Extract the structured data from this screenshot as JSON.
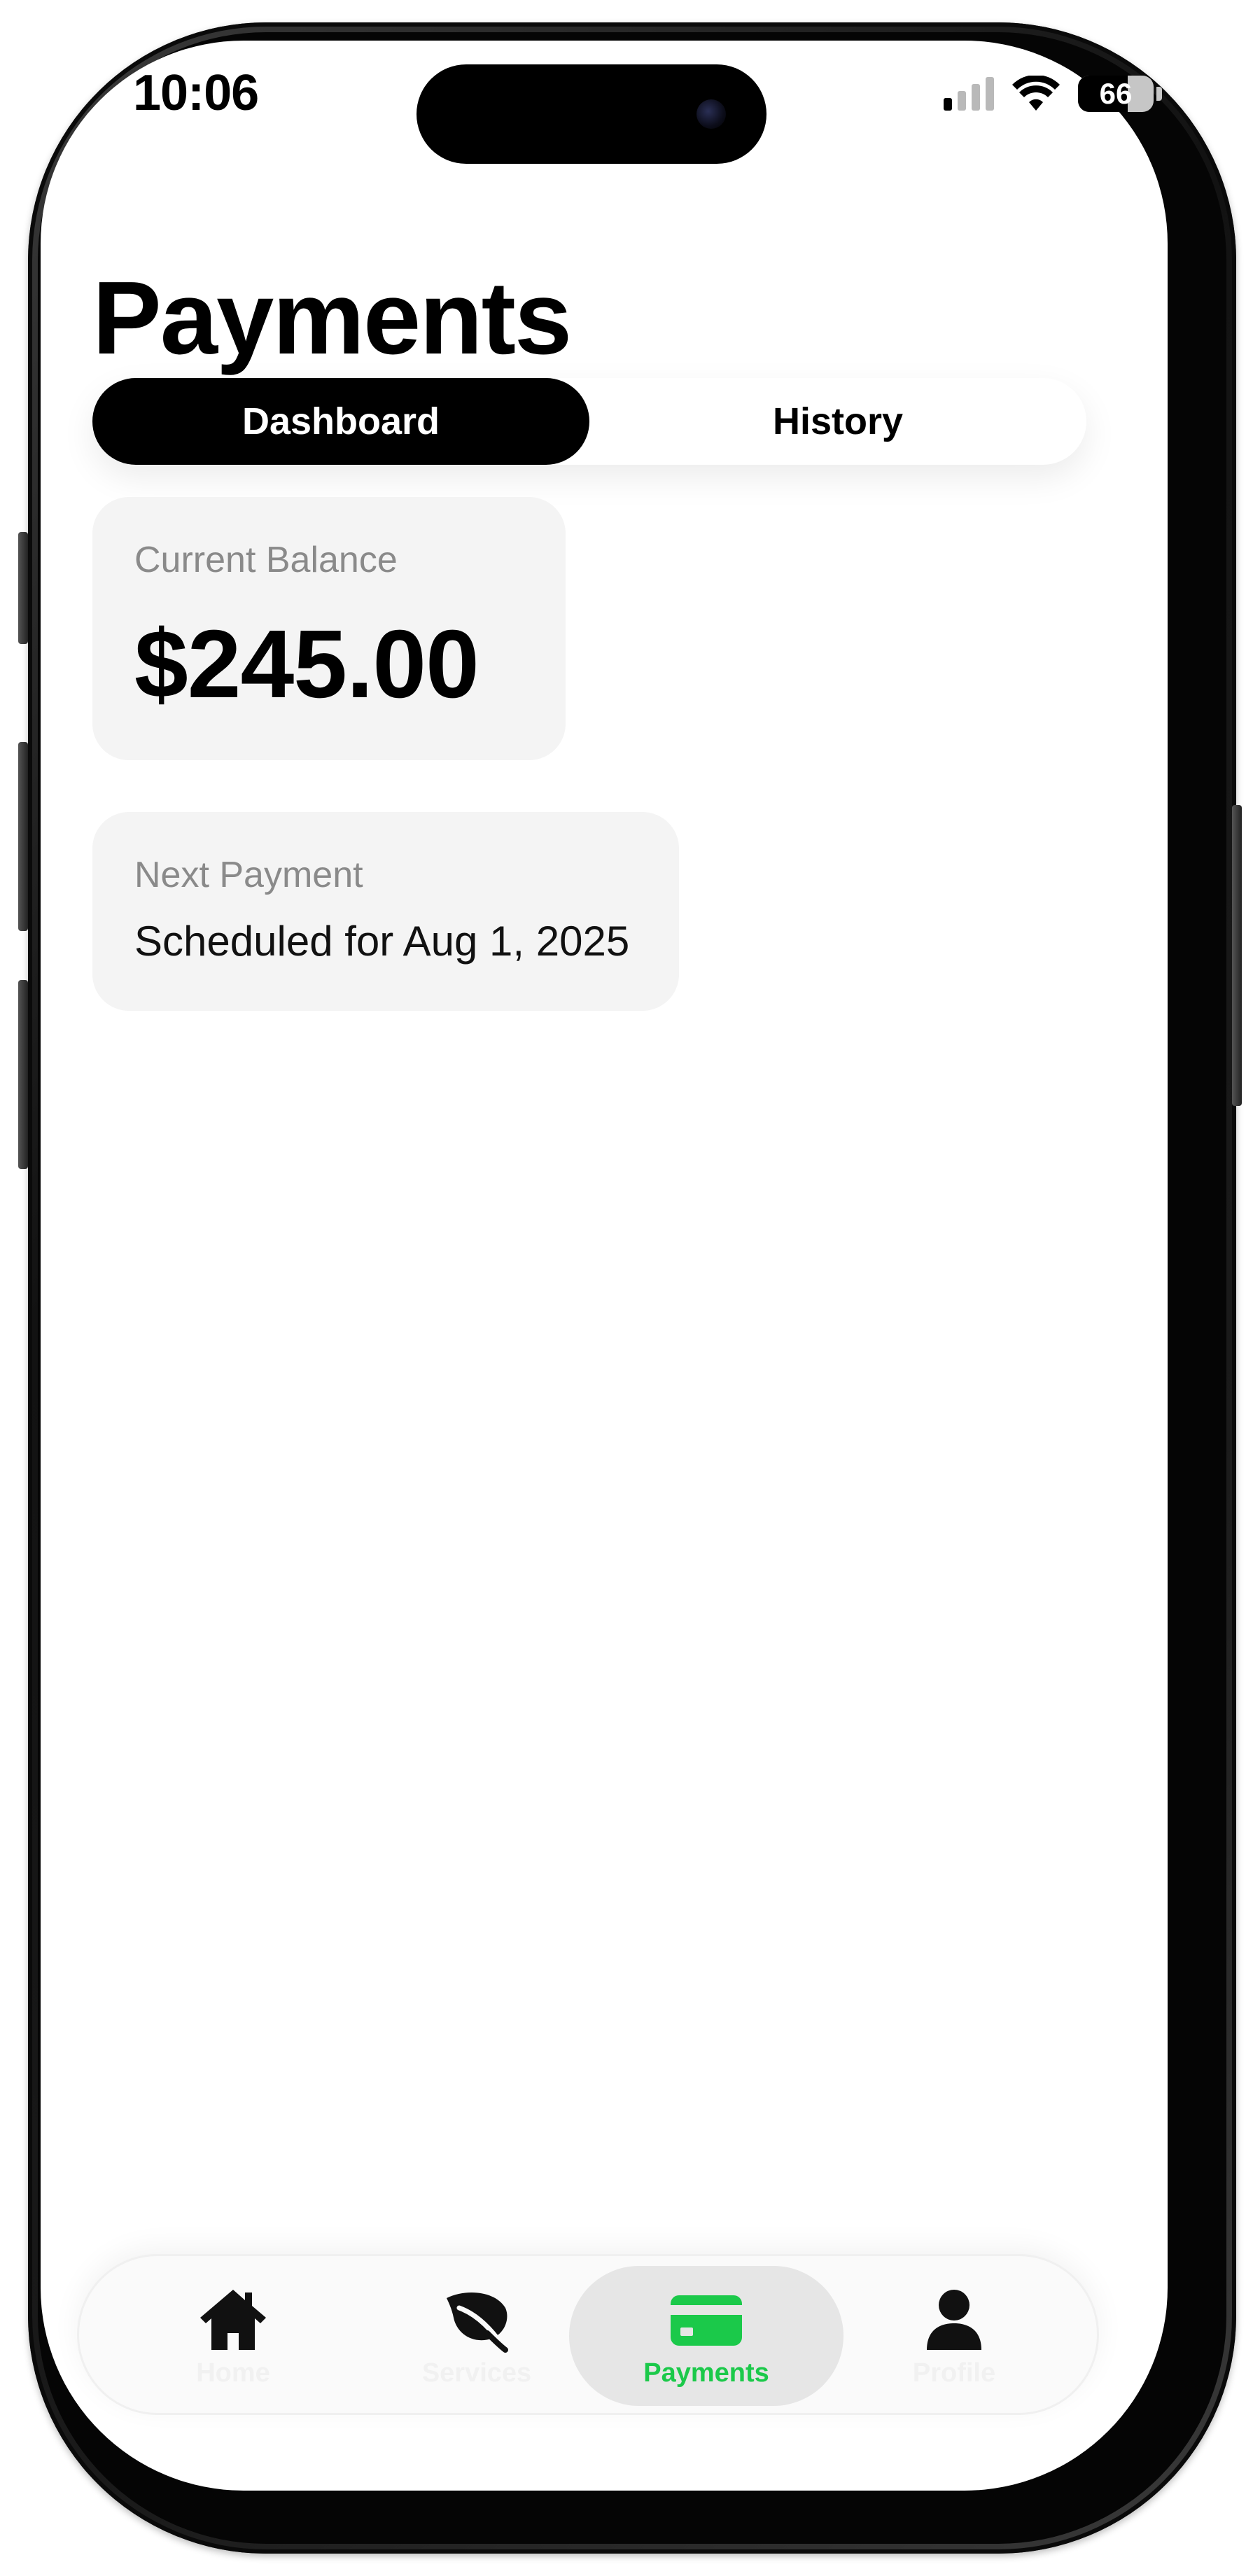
{
  "status_bar": {
    "time": "10:06",
    "battery_level": "66",
    "signal_bars_active": 1,
    "signal_bars_total": 4
  },
  "header": {
    "title": "Payments"
  },
  "segments": {
    "items": [
      {
        "label": "Dashboard",
        "active": true
      },
      {
        "label": "History",
        "active": false
      }
    ]
  },
  "cards": {
    "balance": {
      "label": "Current Balance",
      "amount": "$245.00"
    },
    "next_payment": {
      "label": "Next Payment",
      "text": "Scheduled for Aug 1, 2025"
    }
  },
  "tabbar": {
    "items": [
      {
        "label": "Home",
        "icon": "house-icon",
        "active": false
      },
      {
        "label": "Services",
        "icon": "leaf-icon",
        "active": false
      },
      {
        "label": "Payments",
        "icon": "credit-card-icon",
        "active": true
      },
      {
        "label": "Profile",
        "icon": "person-icon",
        "active": false
      }
    ]
  },
  "colors": {
    "accent": "#1BC94A",
    "card_background": "#F4F4F4",
    "text_primary": "#000000",
    "text_secondary": "#8A8A8A",
    "tab_inactive_label": "#F1F1F1"
  }
}
